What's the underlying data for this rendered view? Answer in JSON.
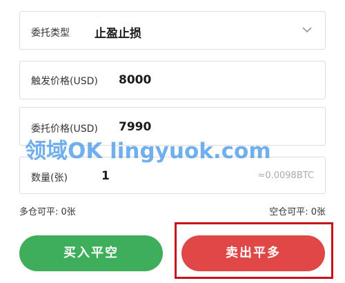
{
  "order_type": {
    "label": "委托类型",
    "value": "止盈止损"
  },
  "trigger_price": {
    "label": "触发价格(USD)",
    "value": "8000"
  },
  "order_price": {
    "label": "委托价格(USD)",
    "value": "7990"
  },
  "quantity": {
    "label": "数量(张)",
    "value": "1",
    "hint": "≈0.0098BTC"
  },
  "available": {
    "long": "多仓可平: 0张",
    "short": "空仓可平: 0张"
  },
  "buttons": {
    "buy_close_short": "买入平空",
    "sell_close_long": "卖出平多"
  },
  "watermark": "领域OK lingyuok.com",
  "colors": {
    "buy": "#3fae5a",
    "sell": "#e04848",
    "highlight": "#c8101a",
    "watermark": "#3a91e8"
  },
  "icons": {
    "dropdown": "chevron-down-icon"
  }
}
